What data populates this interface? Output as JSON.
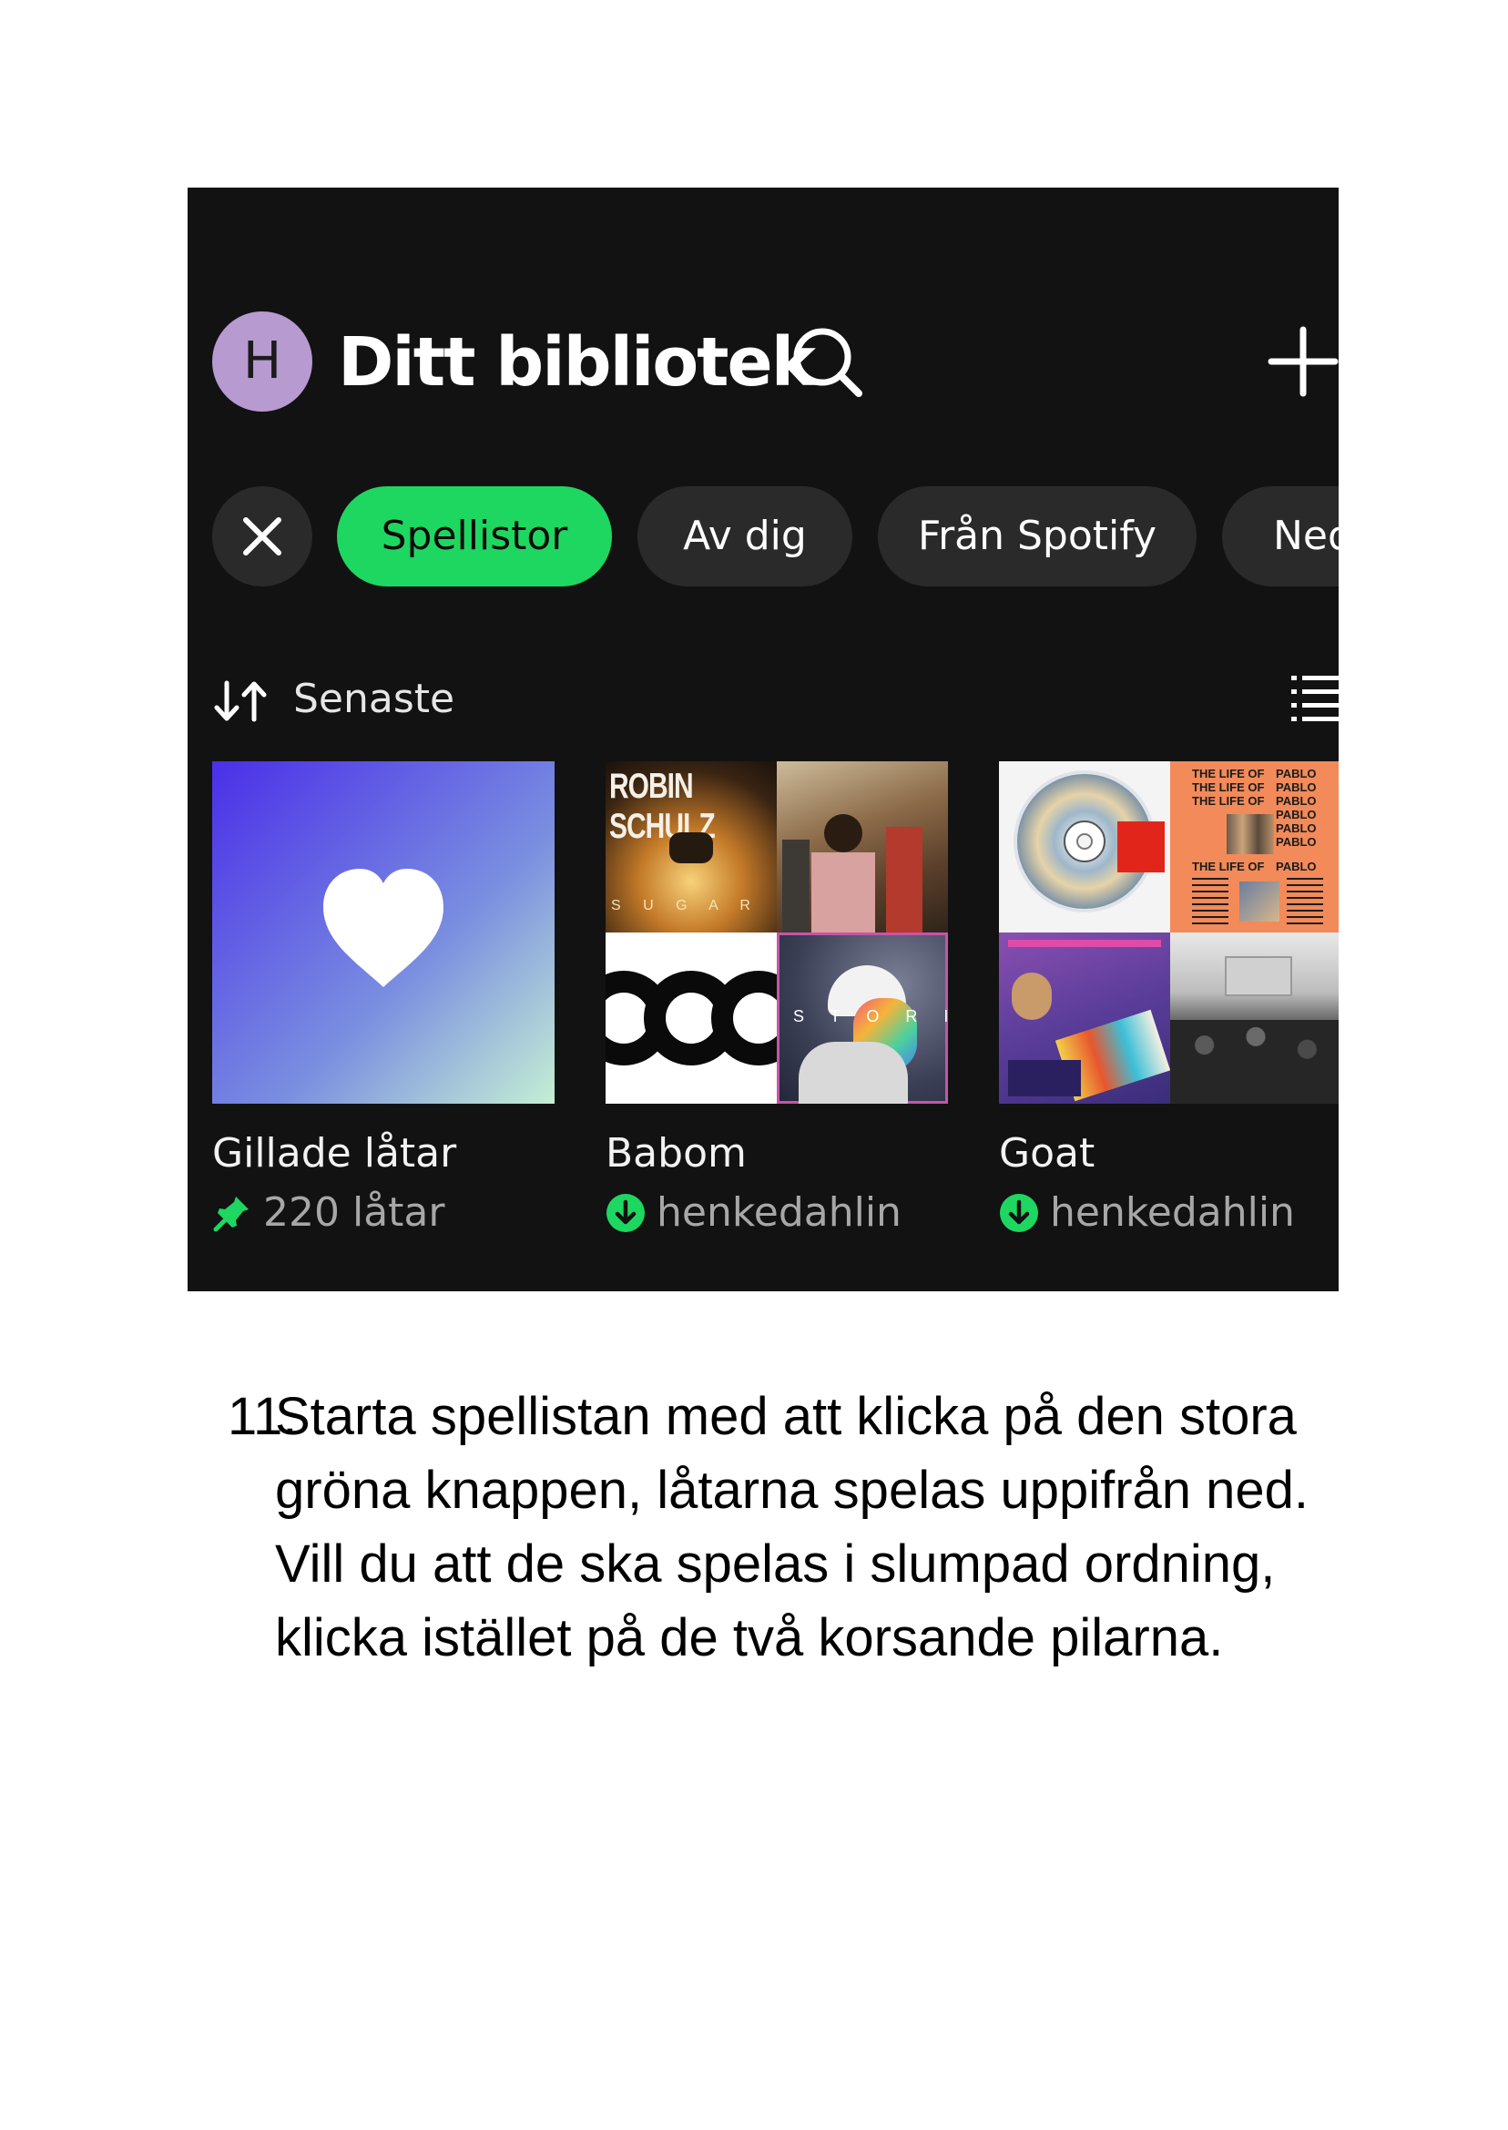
{
  "header": {
    "avatar_initial": "H",
    "title": "Ditt bibliotek"
  },
  "filters": {
    "chips": [
      "Spellistor",
      "Av dig",
      "Från Spotify",
      "Ned"
    ]
  },
  "sort": {
    "label": "Senaste"
  },
  "playlists": [
    {
      "title": "Gillade låtar",
      "subtitle": "220 låtar"
    },
    {
      "title": "Babom",
      "subtitle": "henkedahlin"
    },
    {
      "title": "Goat",
      "subtitle": "henkedahlin"
    }
  ],
  "artwork_text": {
    "robin": "ROBIN SCHULZ",
    "sugar": "S U G A R",
    "stories": "S T O R I E S",
    "pablo_left": "THE LIFE OF",
    "pablo_right": "PABLO"
  },
  "colors": {
    "spotify_green": "#1ed760",
    "background": "#121212",
    "chip": "#2a2a2a",
    "avatar": "#b69ad0"
  },
  "caption": {
    "number": "11.",
    "text": "Starta spellistan med att klicka på den stora gröna knappen, låtarna spelas uppifrån ned. Vill du att de ska spelas i slumpad ordning, klicka istället på de två korsande pilarna."
  }
}
